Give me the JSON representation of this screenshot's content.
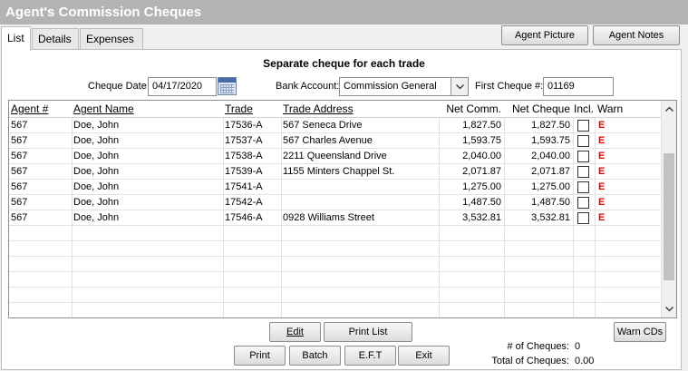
{
  "window": {
    "title": "Agent's Commission Cheques"
  },
  "tabs": [
    {
      "label": "List",
      "active": true
    },
    {
      "label": "Details",
      "active": false
    },
    {
      "label": "Expenses",
      "active": false
    }
  ],
  "top_buttons": {
    "agent_picture": "Agent Picture",
    "agent_notes": "Agent Notes"
  },
  "heading": "Separate cheque for each trade",
  "form": {
    "cheque_date_label": "Cheque Date:",
    "cheque_date_value": "04/17/2020",
    "bank_account_label": "Bank Account:",
    "bank_account_value": "Commission General",
    "first_cheque_label": "First Cheque #:",
    "first_cheque_value": "01169"
  },
  "table": {
    "columns": [
      "Agent #",
      "Agent Name",
      "Trade",
      "Trade Address",
      "Net Comm.",
      "Net Cheque",
      "Incl.",
      "Warn"
    ],
    "rows": [
      {
        "agent": "567",
        "name": "Doe, John",
        "trade": "17536-A",
        "address": "567 Seneca Drive",
        "net_comm": "1,827.50",
        "net_cheque": "1,827.50",
        "incl": false,
        "warn": "E"
      },
      {
        "agent": "567",
        "name": "Doe, John",
        "trade": "17537-A",
        "address": "567 Charles Avenue",
        "net_comm": "1,593.75",
        "net_cheque": "1,593.75",
        "incl": false,
        "warn": "E"
      },
      {
        "agent": "567",
        "name": "Doe, John",
        "trade": "17538-A",
        "address": "2211 Queensland Drive",
        "net_comm": "2,040.00",
        "net_cheque": "2,040.00",
        "incl": false,
        "warn": "E"
      },
      {
        "agent": "567",
        "name": "Doe, John",
        "trade": "17539-A",
        "address": "1155 Minters Chappel St.",
        "net_comm": "2,071.87",
        "net_cheque": "2,071.87",
        "incl": false,
        "warn": "E"
      },
      {
        "agent": "567",
        "name": "Doe, John",
        "trade": "17541-A",
        "address": "",
        "net_comm": "1,275.00",
        "net_cheque": "1,275.00",
        "incl": false,
        "warn": "E"
      },
      {
        "agent": "567",
        "name": "Doe, John",
        "trade": "17542-A",
        "address": "",
        "net_comm": "1,487.50",
        "net_cheque": "1,487.50",
        "incl": false,
        "warn": "E"
      },
      {
        "agent": "567",
        "name": "Doe, John",
        "trade": "17546-A",
        "address": "0928 Williams Street",
        "net_comm": "3,532.81",
        "net_cheque": "3,532.81",
        "incl": false,
        "warn": "E"
      }
    ]
  },
  "bottom_buttons": {
    "edit": "Edit",
    "print_list": "Print List",
    "warn_cds": "Warn CDs",
    "print": "Print",
    "batch": "Batch",
    "eft": "E.F.T",
    "exit": "Exit"
  },
  "totals": {
    "num_cheques_label": "# of Cheques:",
    "num_cheques_value": "0",
    "total_cheques_label": "Total of Cheques:",
    "total_cheques_value": "0.00"
  },
  "colors": {
    "warn": "#e00000",
    "titlebar": "#b3b3b3"
  },
  "icons": {
    "calendar": "calendar-icon",
    "dropdown": "chevron-down-icon"
  }
}
